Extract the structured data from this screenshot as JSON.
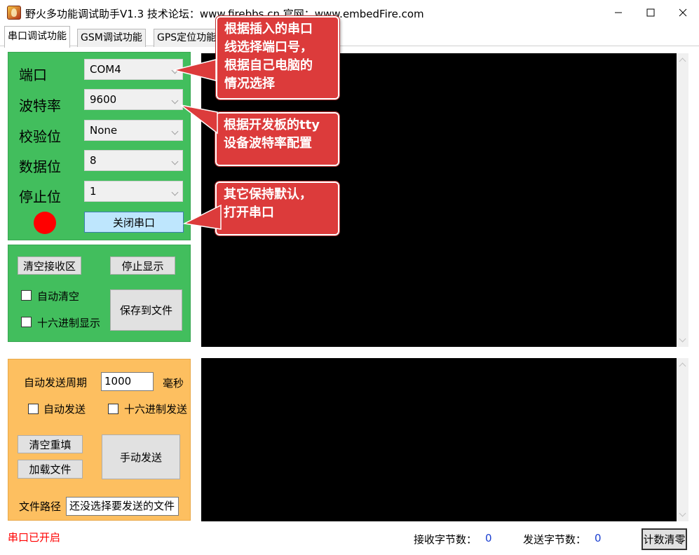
{
  "window": {
    "title": "野火多功能调试助手V1.3    技术论坛：www.firebbs.cn   官网：www.embedFire.com"
  },
  "tabs": [
    {
      "label": "串口调试功能",
      "active": true
    },
    {
      "label": "GSM调试功能",
      "active": false
    },
    {
      "label": "GPS定位功能",
      "active": false
    }
  ],
  "serial": {
    "port_label": "端口",
    "port_value": "COM4",
    "baud_label": "波特率",
    "baud_value": "9600",
    "parity_label": "校验位",
    "parity_value": "None",
    "databits_label": "数据位",
    "databits_value": "8",
    "stopbits_label": "停止位",
    "stopbits_value": "1",
    "toggle_button": "关闭串口",
    "led_color": "#ff0000"
  },
  "receive": {
    "clear_button": "清空接收区",
    "stop_button": "停止显示",
    "auto_clear_label": "自动清空",
    "hex_display_label": "十六进制显示",
    "save_button": "保存到文件"
  },
  "send": {
    "period_label": "自动发送周期",
    "period_value": "1000",
    "period_unit": "毫秒",
    "auto_send_label": "自动发送",
    "hex_send_label": "十六进制发送",
    "clear_button": "清空重填",
    "load_button": "加载文件",
    "manual_button": "手动发送",
    "path_label": "文件路径",
    "path_value": "还没选择要发送的文件"
  },
  "status": {
    "port_state": "串口已开启",
    "rx_label": "接收字节数：",
    "rx_count": "0",
    "tx_label": "发送字节数：",
    "tx_count": "0",
    "reset_button": "计数清零"
  },
  "callouts": {
    "c1": [
      "根据插入的串口",
      "线选择端口号，",
      "根据自己电脑的",
      "情况选择"
    ],
    "c2": [
      "根据开发板的tty",
      "设备波特率配置"
    ],
    "c3": [
      "其它保持默认，",
      "打开串口"
    ]
  },
  "colors": {
    "serial_panel": "#42be5d",
    "send_panel": "#fdbf60",
    "callout": "#dc3b3b",
    "terminal": "#000000"
  }
}
